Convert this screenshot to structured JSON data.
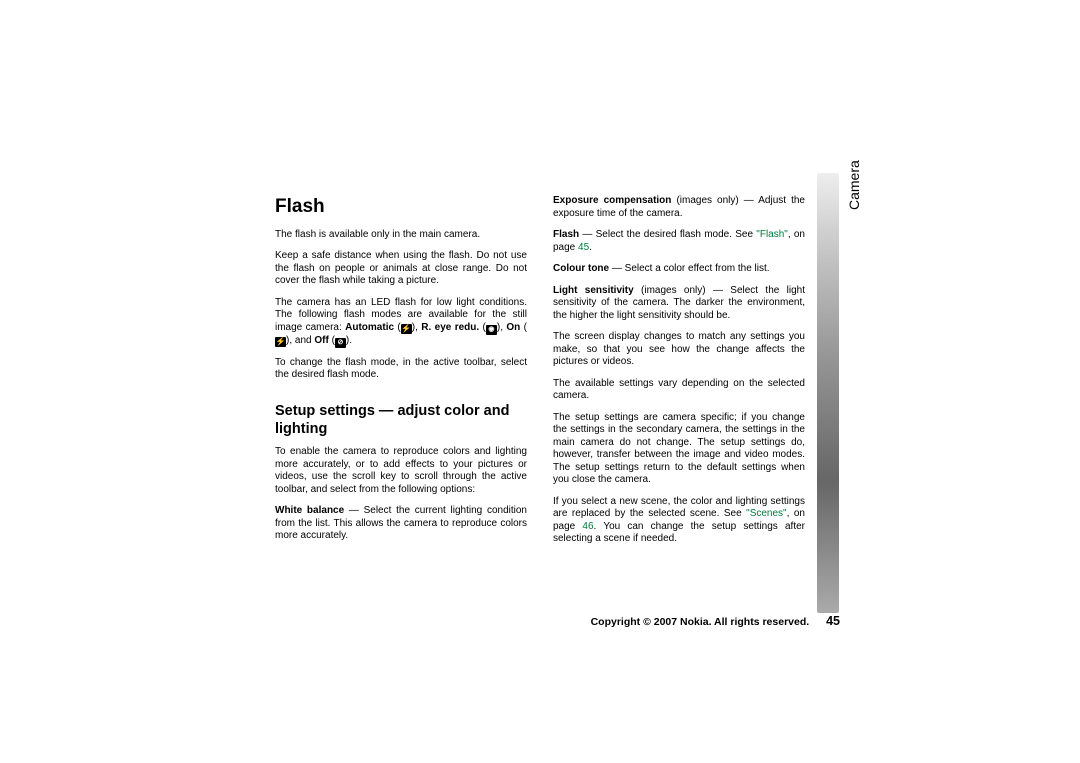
{
  "tab": "Camera",
  "left": {
    "h1": "Flash",
    "p1": "The flash is available only in the main camera.",
    "p2": "Keep a safe distance when using the flash. Do not use the flash on people or animals at close range. Do not cover the flash while taking a picture.",
    "p3a": "The camera has an LED flash for low light conditions. The following flash modes are available for the still image camera: ",
    "auto": "Automatic",
    "red": "R. eye redu.",
    "on": "On",
    "off": "Off",
    "p4": "To change the flash mode, in the active toolbar, select the desired flash mode.",
    "h2": "Setup settings — adjust color and lighting",
    "p5": "To enable the camera to reproduce colors and lighting more accurately, or to add effects to your pictures or videos, use the scroll key to scroll through the active toolbar, and select from the following options:",
    "wb_label": "White balance",
    "wb_text": " — Select the current lighting condition from the list. This allows the camera to reproduce colors more accurately."
  },
  "right": {
    "exp_label": "Exposure compensation",
    "exp_text": " (images only) — Adjust the exposure time of the camera.",
    "flash_label": "Flash",
    "flash_text_a": " — Select the desired flash mode. See ",
    "flash_ref": "\"Flash\"",
    "flash_text_b": ", on page ",
    "flash_page": "45",
    "ct_label": "Colour tone",
    "ct_text": " — Select a color effect from the list.",
    "ls_label": "Light sensitivity",
    "ls_text": " (images only) — Select the light sensitivity of the camera. The darker the environment, the higher the light sensitivity should be.",
    "p1": "The screen display changes to match any settings you make, so that you see how the change affects the pictures or videos.",
    "p2": "The available settings vary depending on the selected camera.",
    "p3": "The setup settings are camera specific; if you change the settings in the secondary camera, the settings in the main camera do not change. The setup settings do, however, transfer between the image and video modes. The setup settings return to the default settings when you close the camera.",
    "p4a": "If you select a new scene, the color and lighting settings are replaced by the selected scene. See ",
    "p4ref": "\"Scenes\"",
    "p4b": ", on page ",
    "p4page": "46",
    "p4c": ". You can change the setup settings after selecting a scene if needed."
  },
  "footer": {
    "copyright": "Copyright © 2007 Nokia. All rights reserved.",
    "page": "45"
  }
}
